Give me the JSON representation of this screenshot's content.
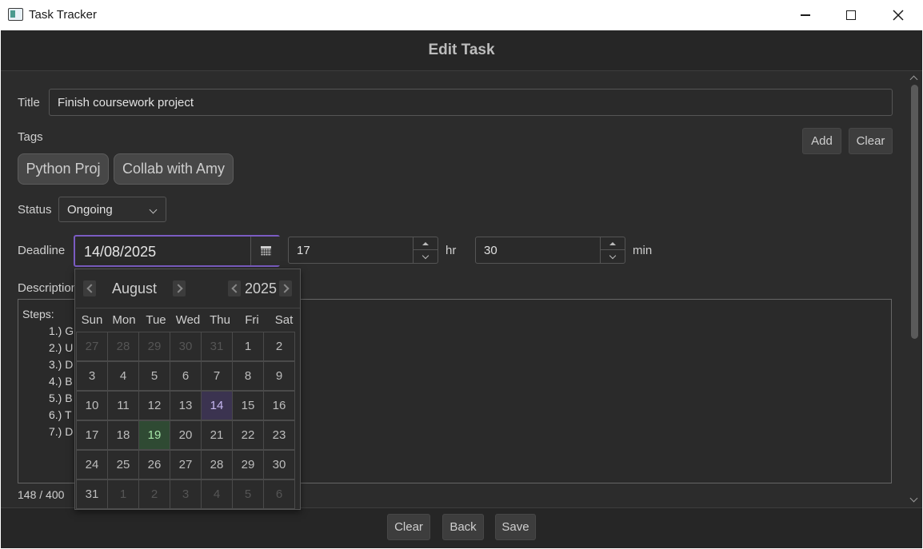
{
  "window": {
    "title": "Task Tracker"
  },
  "header": {
    "title": "Edit Task"
  },
  "form": {
    "title_label": "Title",
    "title_value": "Finish coursework project",
    "tags_label": "Tags",
    "tag_add": "Add",
    "tag_clear": "Clear",
    "tags": [
      "Python Proj",
      "Collab with Amy"
    ],
    "status_label": "Status",
    "status_value": "Ongoing",
    "deadline_label": "Deadline",
    "deadline_date": "14/08/2025",
    "hour_value": "17",
    "hour_unit": "hr",
    "minute_value": "30",
    "minute_unit": "min",
    "description_label": "Description",
    "description_lines": [
      "Steps:",
      "1.) G",
      "2.) U",
      "3.) D",
      "4.) B",
      "5.) B",
      "6.) T",
      "7.) D"
    ],
    "char_count": "148 / 400"
  },
  "calendar": {
    "month": "August",
    "year": "2025",
    "weekdays": [
      "Sun",
      "Mon",
      "Tue",
      "Wed",
      "Thu",
      "Fri",
      "Sat"
    ],
    "weeks": [
      [
        "27",
        "28",
        "29",
        "30",
        "31",
        "1",
        "2"
      ],
      [
        "3",
        "4",
        "5",
        "6",
        "7",
        "8",
        "9"
      ],
      [
        "10",
        "11",
        "12",
        "13",
        "14",
        "15",
        "16"
      ],
      [
        "17",
        "18",
        "19",
        "20",
        "21",
        "22",
        "23"
      ],
      [
        "24",
        "25",
        "26",
        "27",
        "28",
        "29",
        "30"
      ],
      [
        "31",
        "1",
        "2",
        "3",
        "4",
        "5",
        "6"
      ]
    ],
    "selected_day": "14",
    "today_day": "19"
  },
  "footer": {
    "clear": "Clear",
    "back": "Back",
    "save": "Save"
  },
  "colors": {
    "accent": "#7b5cc2",
    "selected_bg": "#3b3350",
    "today_bg": "#2f4a33",
    "background": "#2c2c2c"
  }
}
